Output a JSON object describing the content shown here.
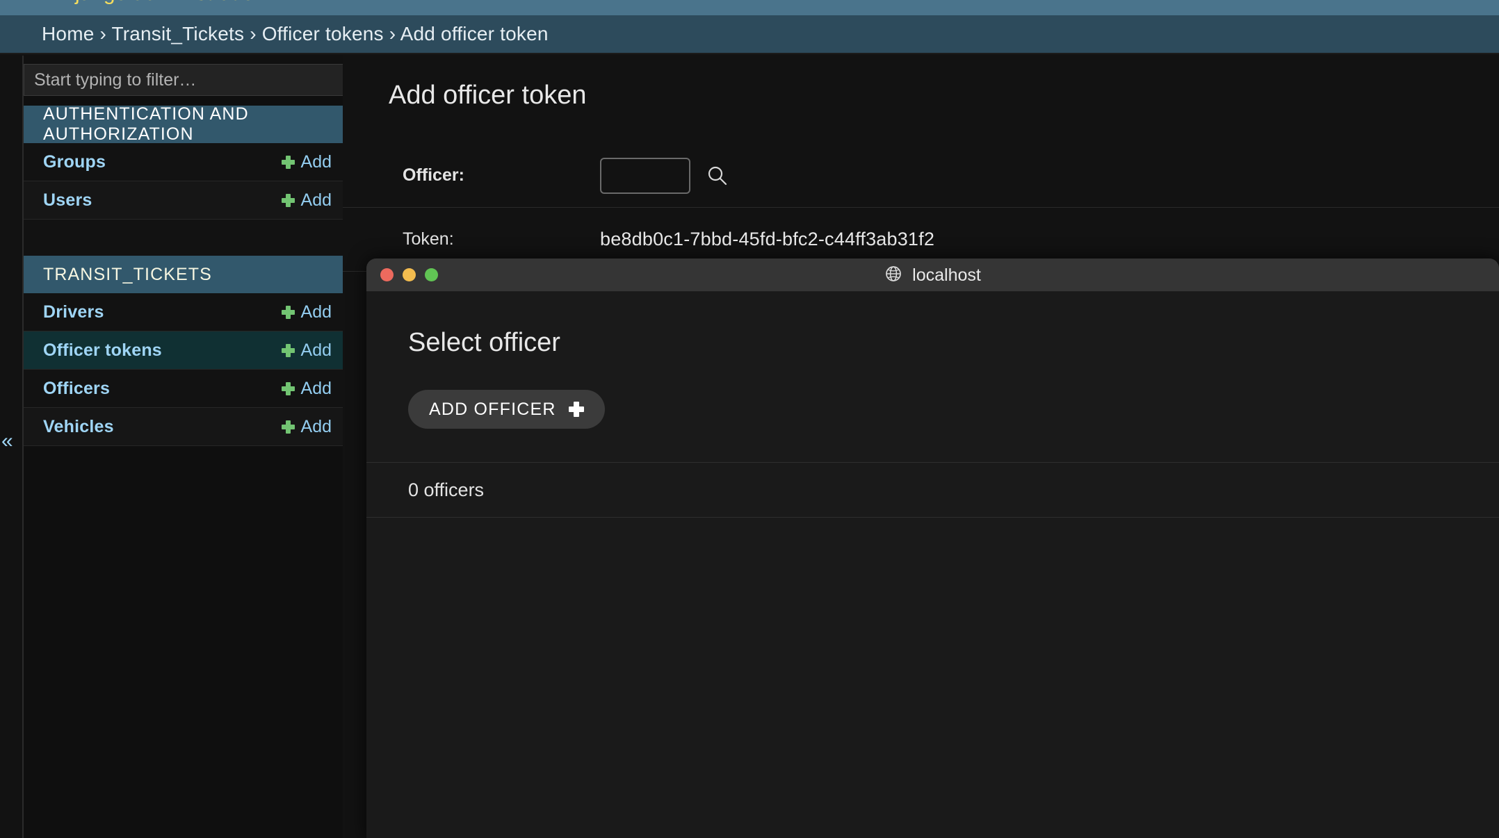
{
  "brand": {
    "text": "Django administration"
  },
  "breadcrumb": {
    "text": "Home › Transit_Tickets › Officer tokens › Add officer token"
  },
  "sidebar": {
    "filter_placeholder": "Start typing to filter…",
    "filter_value": "",
    "collapse_label": "«",
    "apps": [
      {
        "title": "AUTHENTICATION AND AUTHORIZATION",
        "models": [
          {
            "name": "Groups",
            "add_label": "Add",
            "current": false
          },
          {
            "name": "Users",
            "add_label": "Add",
            "current": false
          }
        ]
      },
      {
        "title": "TRANSIT_TICKETS",
        "models": [
          {
            "name": "Drivers",
            "add_label": "Add",
            "current": false
          },
          {
            "name": "Officer tokens",
            "add_label": "Add",
            "current": true
          },
          {
            "name": "Officers",
            "add_label": "Add",
            "current": false
          },
          {
            "name": "Vehicles",
            "add_label": "Add",
            "current": false
          }
        ]
      }
    ]
  },
  "main": {
    "title": "Add officer token",
    "fields": {
      "officer_label": "Officer:",
      "officer_value": "",
      "officer_lookup_icon": "search-icon",
      "token_label": "Token:",
      "token_value": "be8db0c1-7bbd-45fd-bfc2-c44ff3ab31f2"
    }
  },
  "popup": {
    "window_title": "localhost",
    "window_icon": "globe-icon",
    "traffic_lights": [
      "close",
      "minimize",
      "maximize"
    ],
    "heading": "Select officer",
    "add_officer_label": "ADD OFFICER",
    "count_text": "0 officers"
  },
  "colors": {
    "brand_bar": "#4a748c",
    "breadcrumb_bar": "#2d4b5c",
    "app_header": "#32586c",
    "link_blue": "#9fd5f5",
    "plus_green": "#72c472",
    "current_row": "#103033",
    "page_bg": "#121212"
  }
}
